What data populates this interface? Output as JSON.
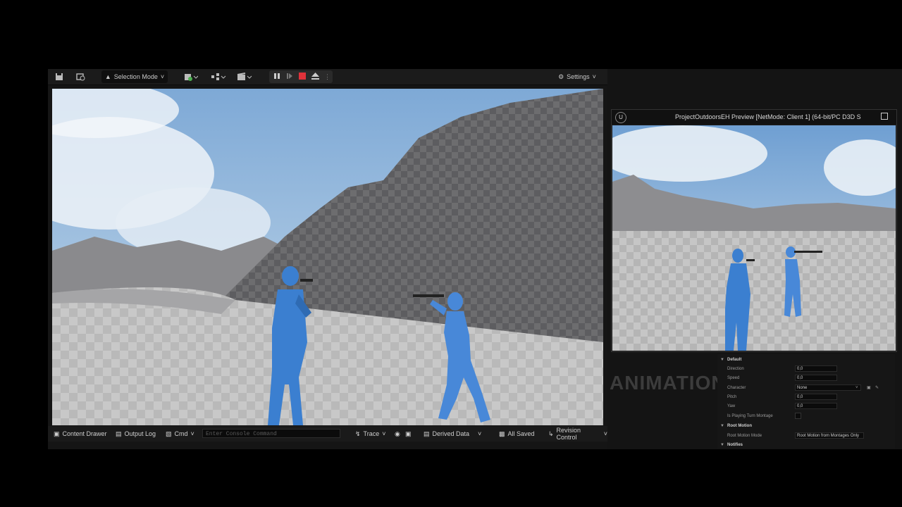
{
  "toolbar": {
    "selection_mode": "Selection Mode",
    "settings": "Settings",
    "icons": [
      "save-icon",
      "content-browser-icon",
      "add-actor-icon",
      "blueprint-icon",
      "cinematics-icon",
      "pause-icon",
      "step-icon",
      "stop-icon",
      "eject-icon",
      "more-icon",
      "gear-icon"
    ]
  },
  "bottombar": {
    "content_drawer": "Content Drawer",
    "output_log": "Output Log",
    "cmd": "Cmd",
    "console_placeholder": "Enter Console Command",
    "trace": "Trace",
    "derived_data": "Derived Data",
    "all_saved": "All Saved",
    "revision_control": "Revision Control"
  },
  "pie_window": {
    "title": "ProjectOutdoorsEH Preview [NetMode: Client 1]  (64-bit/PC D3D S"
  },
  "background_label": "ANIMATION",
  "details": {
    "default_section": "Default",
    "rows": [
      {
        "label": "Direction",
        "value": "0,0"
      },
      {
        "label": "Speed",
        "value": "0,0"
      },
      {
        "label": "Character",
        "value": "None"
      },
      {
        "label": "Pitch",
        "value": "0,0"
      },
      {
        "label": "Yaw",
        "value": "0,0"
      },
      {
        "label": "Is Playing Turn Montage",
        "value": ""
      }
    ],
    "root_motion_section": "Root Motion",
    "root_motion_mode_label": "Root Motion Mode",
    "root_motion_mode_value": "Root Motion from Montages Only",
    "notifies_section": "Notifies"
  },
  "colors": {
    "stop_red": "#e0323a",
    "sky": "#8fb7dc",
    "character_blue": "#3b7fd0"
  }
}
